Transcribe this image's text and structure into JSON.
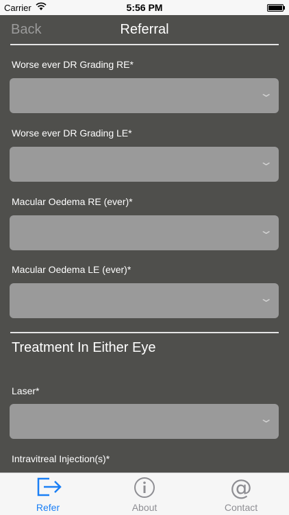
{
  "status_bar": {
    "carrier": "Carrier",
    "time": "5:56 PM"
  },
  "nav": {
    "back_label": "Back",
    "title": "Referral"
  },
  "fields": [
    {
      "label": "Worse ever DR Grading RE*",
      "value": ""
    },
    {
      "label": "Worse ever DR Grading LE*",
      "value": ""
    },
    {
      "label": "Macular Oedema RE (ever)*",
      "value": ""
    },
    {
      "label": "Macular Oedema LE (ever)*",
      "value": ""
    }
  ],
  "section": {
    "title": "Treatment In Either Eye"
  },
  "treatment_fields": [
    {
      "label": "Laser*",
      "value": ""
    },
    {
      "label": "Intravitreal Injection(s)*",
      "value": ""
    }
  ],
  "tabs": [
    {
      "label": "Refer",
      "icon": "refer-arrow-icon",
      "selected": true
    },
    {
      "label": "About",
      "icon": "info-icon",
      "selected": false
    },
    {
      "label": "Contact",
      "icon": "at-sign-icon",
      "selected": false
    }
  ],
  "colors": {
    "accent": "#1a7ff5",
    "background": "#4f4f4c",
    "field": "#9a9a9a",
    "tab_inactive": "#8e8e93"
  }
}
